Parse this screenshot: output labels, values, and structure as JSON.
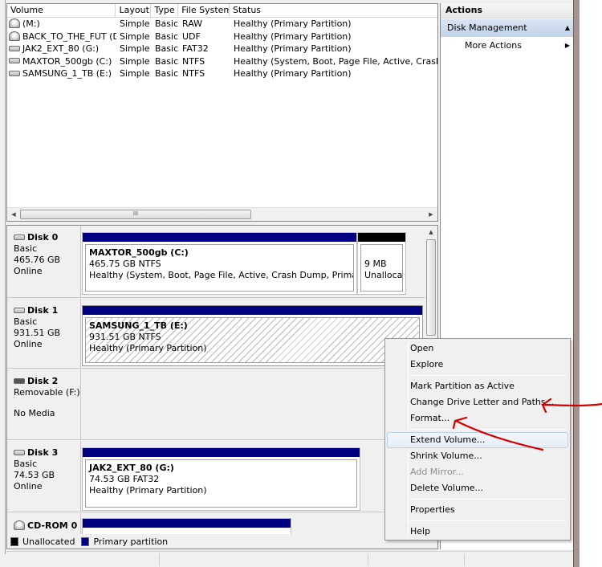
{
  "volume_list": {
    "columns": [
      "Volume",
      "Layout",
      "Type",
      "File System",
      "Status"
    ],
    "rows": [
      {
        "icon": "cd-drive-icon",
        "volume": "(M:)",
        "layout": "Simple",
        "type": "Basic",
        "fs": "RAW",
        "status": "Healthy (Primary Partition)"
      },
      {
        "icon": "cd-drive-icon",
        "volume": "BACK_TO_THE_FUT (D:)",
        "layout": "Simple",
        "type": "Basic",
        "fs": "UDF",
        "status": "Healthy (Primary Partition)"
      },
      {
        "icon": "hard-drive-icon",
        "volume": "JAK2_EXT_80 (G:)",
        "layout": "Simple",
        "type": "Basic",
        "fs": "FAT32",
        "status": "Healthy (Primary Partition)"
      },
      {
        "icon": "hard-drive-icon",
        "volume": "MAXTOR_500gb (C:)",
        "layout": "Simple",
        "type": "Basic",
        "fs": "NTFS",
        "status": "Healthy (System, Boot, Page File, Active, Crash Dump"
      },
      {
        "icon": "hard-drive-icon",
        "volume": "SAMSUNG_1_TB (E:)",
        "layout": "Simple",
        "type": "Basic",
        "fs": "NTFS",
        "status": "Healthy (Primary Partition)"
      }
    ],
    "scroll_thumb_glyph": "III"
  },
  "disks": [
    {
      "name": "Disk 0",
      "kind": "Basic",
      "size": "465.76 GB",
      "state": "Online",
      "partitions": [
        {
          "name": "MAXTOR_500gb  (C:)",
          "detail": "465.75 GB NTFS",
          "status": "Healthy (System, Boot, Page File, Active, Crash Dump, Primary Partiti"
        },
        {
          "name": "",
          "detail": "9 MB",
          "status": "Unallocat"
        }
      ]
    },
    {
      "name": "Disk 1",
      "kind": "Basic",
      "size": "931.51 GB",
      "state": "Online",
      "partitions": [
        {
          "name": "SAMSUNG_1_TB  (E:)",
          "detail": "931.51 GB NTFS",
          "status": "Healthy (Primary Partition)"
        }
      ]
    },
    {
      "name": "Disk 2",
      "kind": "Removable (F:)",
      "size": "",
      "state": "No Media",
      "partitions": []
    },
    {
      "name": "Disk 3",
      "kind": "Basic",
      "size": "74.53 GB",
      "state": "Online",
      "partitions": [
        {
          "name": "JAK2_EXT_80  (G:)",
          "detail": "74.53 GB FAT32",
          "status": "Healthy (Primary Partition)"
        }
      ]
    },
    {
      "name": "CD-ROM 0",
      "kind": "",
      "size": "",
      "state": "",
      "partitions": []
    }
  ],
  "legend": {
    "unallocated": "Unallocated",
    "primary": "Primary partition",
    "colors": {
      "unallocated": "#000000",
      "primary": "#000080"
    }
  },
  "actions": {
    "title": "Actions",
    "section": "Disk Management",
    "more": "More Actions"
  },
  "context_menu": {
    "items": [
      {
        "label": "Open",
        "disabled": false
      },
      {
        "label": "Explore",
        "disabled": false
      },
      {
        "label": "Mark Partition as Active",
        "disabled": false
      },
      {
        "label": "Change Drive Letter and Paths...",
        "disabled": false
      },
      {
        "label": "Format...",
        "disabled": false
      },
      {
        "label": "Extend Volume...",
        "disabled": false,
        "highlighted": true
      },
      {
        "label": "Shrink Volume...",
        "disabled": false
      },
      {
        "label": "Add Mirror...",
        "disabled": true
      },
      {
        "label": "Delete Volume...",
        "disabled": false
      },
      {
        "label": "Properties",
        "disabled": false
      },
      {
        "label": "Help",
        "disabled": false
      }
    ]
  },
  "annotation_color": "#d40000"
}
